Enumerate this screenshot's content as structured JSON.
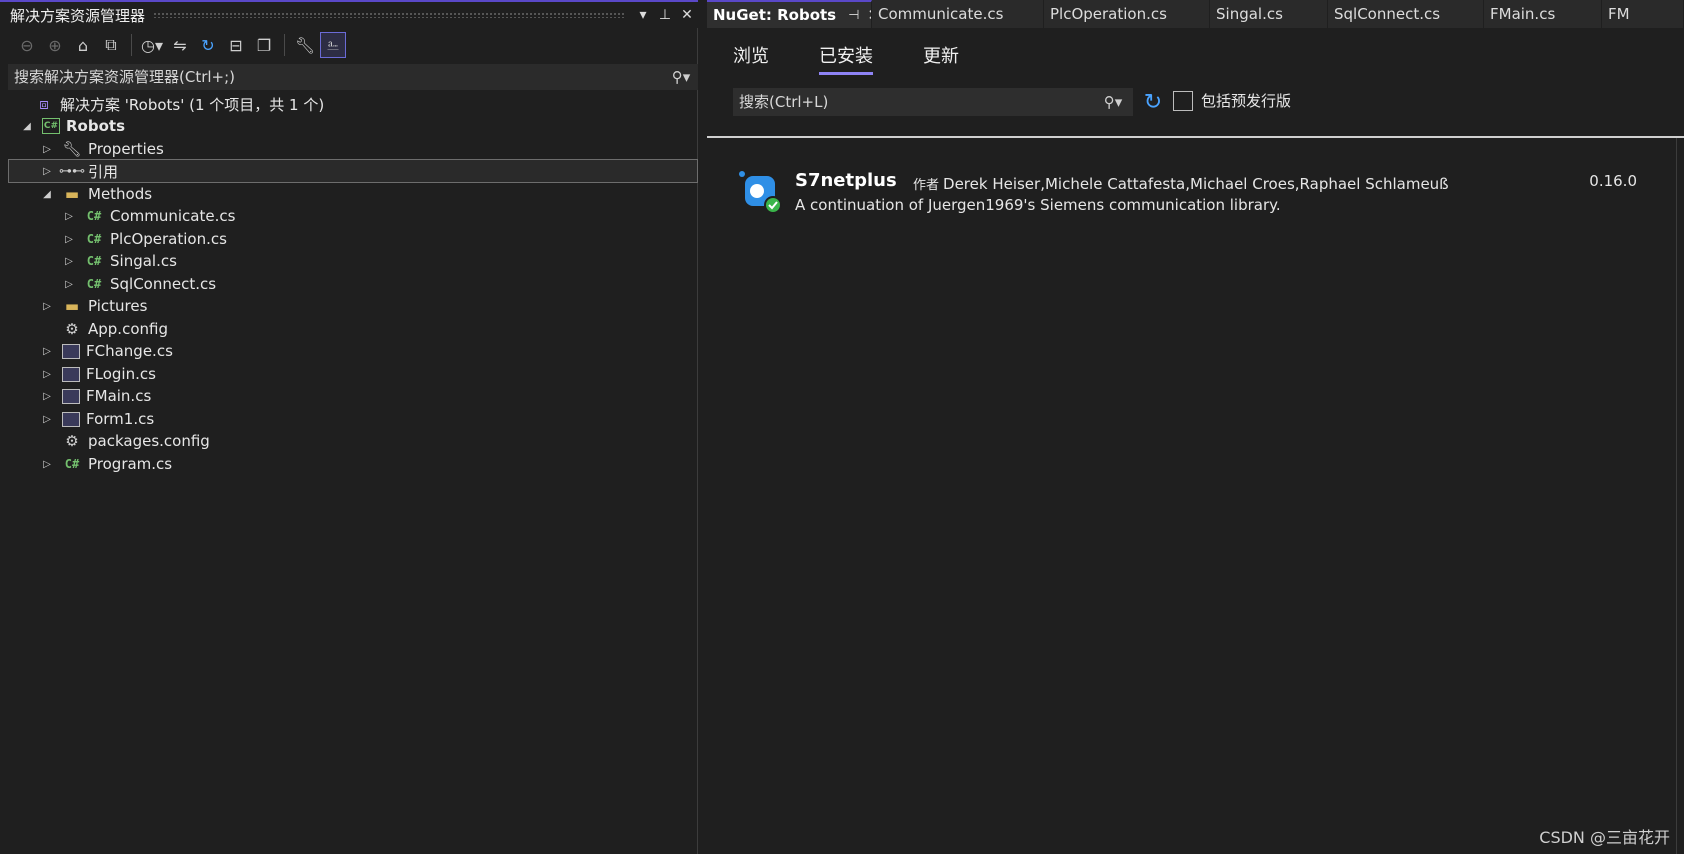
{
  "solution_explorer": {
    "title": "解决方案资源管理器",
    "controls": [
      "▾",
      "⊥",
      "✕"
    ],
    "search_placeholder": "搜索解决方案资源管理器(Ctrl+;)",
    "tree": [
      {
        "label": "解决方案 'Robots' (1 个项目，共 1 个)",
        "icon": "solution-icon",
        "depth": 0,
        "expander": ""
      },
      {
        "label": "Robots",
        "icon": "csharp-project-icon",
        "depth": 0,
        "expander": "◢",
        "bold": true
      },
      {
        "label": "Properties",
        "icon": "wrench-icon",
        "depth": 1,
        "expander": "▷"
      },
      {
        "label": "引用",
        "icon": "references-icon",
        "depth": 1,
        "expander": "▷",
        "selected": true
      },
      {
        "label": "Methods",
        "icon": "folder-icon",
        "depth": 1,
        "expander": "◢"
      },
      {
        "label": "Communicate.cs",
        "icon": "csharp-file-icon",
        "depth": 2,
        "expander": "▷"
      },
      {
        "label": "PlcOperation.cs",
        "icon": "csharp-file-icon",
        "depth": 2,
        "expander": "▷"
      },
      {
        "label": "Singal.cs",
        "icon": "csharp-file-icon",
        "depth": 2,
        "expander": "▷"
      },
      {
        "label": "SqlConnect.cs",
        "icon": "csharp-file-icon",
        "depth": 2,
        "expander": "▷"
      },
      {
        "label": "Pictures",
        "icon": "folder-icon",
        "depth": 1,
        "expander": "▷"
      },
      {
        "label": "App.config",
        "icon": "config-icon",
        "depth": 1,
        "expander": ""
      },
      {
        "label": "FChange.cs",
        "icon": "form-icon",
        "depth": 1,
        "expander": "▷"
      },
      {
        "label": "FLogin.cs",
        "icon": "form-icon",
        "depth": 1,
        "expander": "▷"
      },
      {
        "label": "FMain.cs",
        "icon": "form-icon",
        "depth": 1,
        "expander": "▷"
      },
      {
        "label": "Form1.cs",
        "icon": "form-icon",
        "depth": 1,
        "expander": "▷"
      },
      {
        "label": "packages.config",
        "icon": "config-icon",
        "depth": 1,
        "expander": ""
      },
      {
        "label": "Program.cs",
        "icon": "csharp-file-icon",
        "depth": 1,
        "expander": "▷"
      }
    ]
  },
  "document_tabs": {
    "active": "NuGet: Robots",
    "others": [
      "Communicate.cs",
      "PlcOperation.cs",
      "Singal.cs",
      "SqlConnect.cs",
      "FMain.cs",
      "FM"
    ]
  },
  "nuget": {
    "tabs": [
      "浏览",
      "已安装",
      "更新"
    ],
    "active_tab": "已安装",
    "search_placeholder": "搜索(Ctrl+L)",
    "prerelease_label": "包括预发行版",
    "package": {
      "name": "S7netplus",
      "by_label": "作者",
      "authors": "Derek Heiser,Michele Cattafesta,Michael Croes,Raphael Schlameuß",
      "description": "A continuation of Juergen1969's Siemens communication library.",
      "version": "0.16.0"
    }
  },
  "watermark": "CSDN @三亩花开",
  "colors": {
    "accent": "#5a48c8",
    "tab_underline": "#8f84f5",
    "csharp": "#74c06e",
    "refresh": "#4aa3ff"
  }
}
